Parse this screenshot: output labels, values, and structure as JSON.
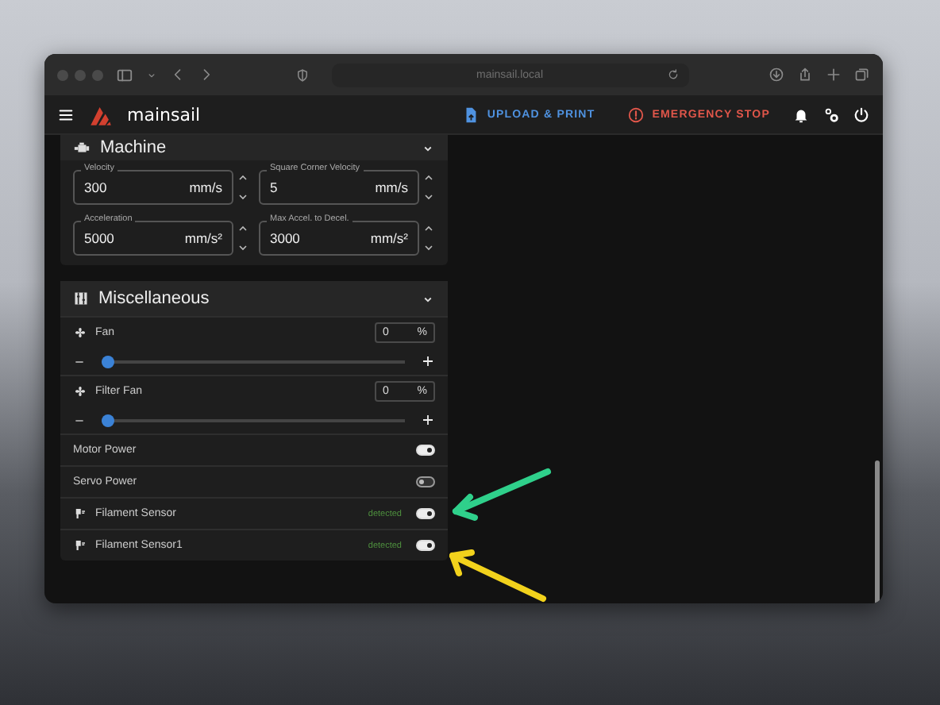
{
  "browser": {
    "address": "mainsail.local"
  },
  "app_bar": {
    "brand": "mainsail",
    "actions": [
      {
        "kind": "upload",
        "label": "UPLOAD & PRINT"
      },
      {
        "kind": "stop",
        "label": "EMERGENCY STOP"
      }
    ]
  },
  "panels": [
    {
      "kind": "fields",
      "title": "Machine",
      "fields": [
        {
          "label": "Velocity",
          "value": "300",
          "unit": "mm/s"
        },
        {
          "label": "Square Corner Velocity",
          "value": "5",
          "unit": "mm/s"
        },
        {
          "label": "Acceleration",
          "value": "5000",
          "unit": "mm/s²"
        },
        {
          "label": "Max Accel. to Decel.",
          "value": "3000",
          "unit": "mm/s²"
        }
      ]
    },
    {
      "kind": "misc",
      "title": "Miscellaneous",
      "items": [
        {
          "kind": "slider",
          "name": "Fan",
          "value": "0",
          "unit": "%",
          "level": 0
        },
        {
          "kind": "slider",
          "name": "Filter Fan",
          "value": "0",
          "unit": "%",
          "level": 0
        },
        {
          "kind": "power",
          "name": "Motor Power",
          "on": true
        },
        {
          "kind": "power",
          "name": "Servo Power",
          "on": false
        },
        {
          "kind": "sensor",
          "name": "Filament Sensor",
          "status": "detected",
          "on": true
        },
        {
          "kind": "sensor",
          "name": "Filament Sensor1",
          "status": "detected",
          "on": true
        }
      ]
    }
  ]
}
